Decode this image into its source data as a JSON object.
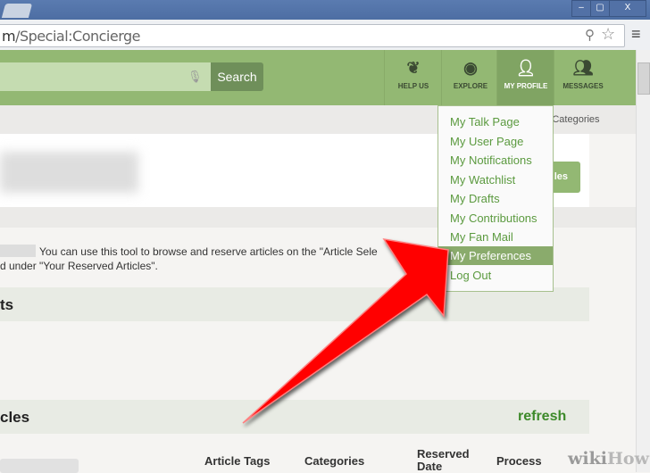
{
  "browser": {
    "url_domain": "m",
    "url_path": "/Special:Concierge",
    "window_buttons": [
      "–",
      "▢",
      "X"
    ]
  },
  "header": {
    "search_button": "Search",
    "nav": [
      {
        "label": "HELP US",
        "icon": "sprout-icon"
      },
      {
        "label": "EXPLORE",
        "icon": "eye-icon"
      },
      {
        "label": "MY PROFILE",
        "icon": "user-icon"
      },
      {
        "label": "MESSAGES",
        "icon": "users-icon"
      }
    ]
  },
  "breadcrumb": "e » Categories",
  "title_button": "les",
  "intro": {
    "line1": "You can use this tool to browse and reserve articles on the \"Article Sele",
    "line2": "d under \"Your Reserved Articles\"."
  },
  "sections": {
    "first": "ts",
    "second": "cles",
    "refresh": "refresh"
  },
  "table_headers": [
    "Article Tags",
    "Categories",
    "Reserved Date",
    "Process"
  ],
  "dropdown": {
    "items": [
      "My Talk Page",
      "My User Page",
      "My Notifications",
      "My Watchlist",
      "My Drafts",
      "My Contributions",
      "My Fan Mail",
      "My Preferences",
      "Log Out"
    ],
    "selected": "My Preferences"
  },
  "watermark": {
    "wiki": "wiki",
    "how": "How"
  },
  "colors": {
    "header_green": "#93b873",
    "link_green": "#5b9a3f",
    "arrow_red": "#ff0000"
  }
}
